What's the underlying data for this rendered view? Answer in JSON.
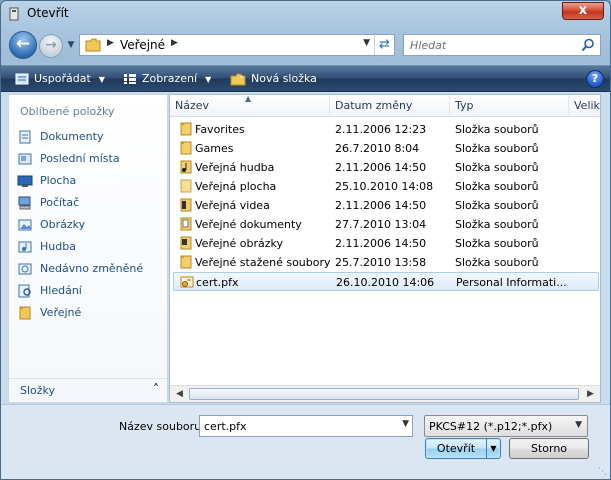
{
  "window": {
    "title": "Otevřít",
    "close_label": "x"
  },
  "nav": {
    "address": {
      "path_label": "Veřejné"
    },
    "search": {
      "placeholder": "Hledat"
    }
  },
  "toolbar": {
    "organize_label": "Uspořádat",
    "views_label": "Zobrazení",
    "new_folder_label": "Nová složka",
    "help_label": "?"
  },
  "sidebar": {
    "header": "Oblíbené položky",
    "items": [
      {
        "label": "Dokumenty",
        "icon": "documents-icon"
      },
      {
        "label": "Poslední místa",
        "icon": "recent-places-icon"
      },
      {
        "label": "Plocha",
        "icon": "desktop-icon"
      },
      {
        "label": "Počítač",
        "icon": "computer-icon"
      },
      {
        "label": "Obrázky",
        "icon": "pictures-icon"
      },
      {
        "label": "Hudba",
        "icon": "music-icon"
      },
      {
        "label": "Nedávno změněné",
        "icon": "recently-changed-icon"
      },
      {
        "label": "Hledání",
        "icon": "searches-icon"
      },
      {
        "label": "Veřejné",
        "icon": "public-folder-icon"
      }
    ],
    "folders_label": "Složky"
  },
  "filelist": {
    "columns": [
      "Název",
      "Datum změny",
      "Typ",
      "Veliko"
    ],
    "rows": [
      {
        "name": "Favorites",
        "date": "2.11.2006 12:23",
        "type": "Složka souborů"
      },
      {
        "name": "Games",
        "date": "26.7.2010 8:04",
        "type": "Složka souborů"
      },
      {
        "name": "Veřejná hudba",
        "date": "2.11.2006 14:50",
        "type": "Složka souborů"
      },
      {
        "name": "Veřejná plocha",
        "date": "25.10.2010 14:08",
        "type": "Složka souborů"
      },
      {
        "name": "Veřejná videa",
        "date": "2.11.2006 14:50",
        "type": "Složka souborů"
      },
      {
        "name": "Veřejné dokumenty",
        "date": "27.7.2010 13:04",
        "type": "Složka souborů"
      },
      {
        "name": "Veřejné obrázky",
        "date": "2.11.2006 14:50",
        "type": "Složka souborů"
      },
      {
        "name": "Veřejné stažené soubory",
        "date": "25.7.2010 13:58",
        "type": "Složka souborů"
      },
      {
        "name": "cert.pfx",
        "date": "26.10.2010 14:06",
        "type": "Personal Informati..."
      }
    ],
    "selected_index": 8
  },
  "footer": {
    "filename_label": "Název souboru:",
    "filename_value": "cert.pfx",
    "filetype_value": "PKCS#12 (*.p12;*.pfx)",
    "open_label": "Otevřít",
    "cancel_label": "Storno"
  },
  "colors": {
    "toolbar_bg": "#2b4a70",
    "link_blue": "#1f4e8c",
    "selection": "#dcebf9"
  }
}
